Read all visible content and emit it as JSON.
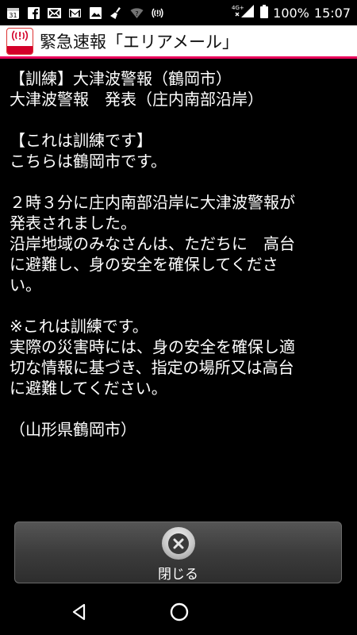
{
  "status_bar": {
    "icons": [
      "calendar-31-icon",
      "facebook-icon",
      "mail-icon",
      "gmail-icon",
      "image-icon",
      "broom-icon",
      "wifi-icon",
      "alert-broadcast-icon",
      "signal-4g-icon"
    ],
    "calendar_day": "31",
    "network": "4G+",
    "battery": "100%",
    "time": "15:07"
  },
  "header": {
    "logo_text": "エリアメール",
    "title": "緊急速報「エリアメール」"
  },
  "message": {
    "lines": [
      "【訓練】大津波警報（鶴岡市）",
      "大津波警報　発表（庄内南部沿岸）",
      "",
      "【これは訓練です】",
      "こちらは鶴岡市です。",
      "",
      "２時３分に庄内南部沿岸に大津波警報が",
      "発表されました。",
      "沿岸地域のみなさんは、ただちに　高台",
      "に避難し、身の安全を確保してくださ",
      "い。",
      "",
      "※これは訓練です。",
      "実際の災害時には、身の安全を確保し適",
      "切な情報に基づき、指定の場所又は高台",
      "に避難してください。",
      "",
      "（山形県鶴岡市）"
    ]
  },
  "close_button": {
    "label": "閉じる"
  },
  "nav": {
    "back": "back-icon",
    "home": "home-icon"
  }
}
